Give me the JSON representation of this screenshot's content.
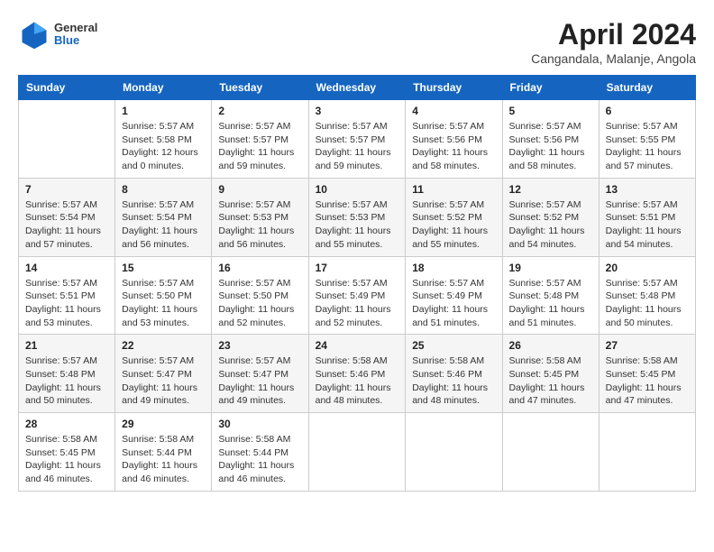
{
  "header": {
    "logo": {
      "general": "General",
      "blue": "Blue"
    },
    "title": "April 2024",
    "subtitle": "Cangandala, Malanje, Angola"
  },
  "calendar": {
    "weekdays": [
      "Sunday",
      "Monday",
      "Tuesday",
      "Wednesday",
      "Thursday",
      "Friday",
      "Saturday"
    ],
    "weeks": [
      [
        {
          "day": "",
          "info": ""
        },
        {
          "day": "1",
          "info": "Sunrise: 5:57 AM\nSunset: 5:58 PM\nDaylight: 12 hours\nand 0 minutes."
        },
        {
          "day": "2",
          "info": "Sunrise: 5:57 AM\nSunset: 5:57 PM\nDaylight: 11 hours\nand 59 minutes."
        },
        {
          "day": "3",
          "info": "Sunrise: 5:57 AM\nSunset: 5:57 PM\nDaylight: 11 hours\nand 59 minutes."
        },
        {
          "day": "4",
          "info": "Sunrise: 5:57 AM\nSunset: 5:56 PM\nDaylight: 11 hours\nand 58 minutes."
        },
        {
          "day": "5",
          "info": "Sunrise: 5:57 AM\nSunset: 5:56 PM\nDaylight: 11 hours\nand 58 minutes."
        },
        {
          "day": "6",
          "info": "Sunrise: 5:57 AM\nSunset: 5:55 PM\nDaylight: 11 hours\nand 57 minutes."
        }
      ],
      [
        {
          "day": "7",
          "info": "Sunrise: 5:57 AM\nSunset: 5:54 PM\nDaylight: 11 hours\nand 57 minutes."
        },
        {
          "day": "8",
          "info": "Sunrise: 5:57 AM\nSunset: 5:54 PM\nDaylight: 11 hours\nand 56 minutes."
        },
        {
          "day": "9",
          "info": "Sunrise: 5:57 AM\nSunset: 5:53 PM\nDaylight: 11 hours\nand 56 minutes."
        },
        {
          "day": "10",
          "info": "Sunrise: 5:57 AM\nSunset: 5:53 PM\nDaylight: 11 hours\nand 55 minutes."
        },
        {
          "day": "11",
          "info": "Sunrise: 5:57 AM\nSunset: 5:52 PM\nDaylight: 11 hours\nand 55 minutes."
        },
        {
          "day": "12",
          "info": "Sunrise: 5:57 AM\nSunset: 5:52 PM\nDaylight: 11 hours\nand 54 minutes."
        },
        {
          "day": "13",
          "info": "Sunrise: 5:57 AM\nSunset: 5:51 PM\nDaylight: 11 hours\nand 54 minutes."
        }
      ],
      [
        {
          "day": "14",
          "info": "Sunrise: 5:57 AM\nSunset: 5:51 PM\nDaylight: 11 hours\nand 53 minutes."
        },
        {
          "day": "15",
          "info": "Sunrise: 5:57 AM\nSunset: 5:50 PM\nDaylight: 11 hours\nand 53 minutes."
        },
        {
          "day": "16",
          "info": "Sunrise: 5:57 AM\nSunset: 5:50 PM\nDaylight: 11 hours\nand 52 minutes."
        },
        {
          "day": "17",
          "info": "Sunrise: 5:57 AM\nSunset: 5:49 PM\nDaylight: 11 hours\nand 52 minutes."
        },
        {
          "day": "18",
          "info": "Sunrise: 5:57 AM\nSunset: 5:49 PM\nDaylight: 11 hours\nand 51 minutes."
        },
        {
          "day": "19",
          "info": "Sunrise: 5:57 AM\nSunset: 5:48 PM\nDaylight: 11 hours\nand 51 minutes."
        },
        {
          "day": "20",
          "info": "Sunrise: 5:57 AM\nSunset: 5:48 PM\nDaylight: 11 hours\nand 50 minutes."
        }
      ],
      [
        {
          "day": "21",
          "info": "Sunrise: 5:57 AM\nSunset: 5:48 PM\nDaylight: 11 hours\nand 50 minutes."
        },
        {
          "day": "22",
          "info": "Sunrise: 5:57 AM\nSunset: 5:47 PM\nDaylight: 11 hours\nand 49 minutes."
        },
        {
          "day": "23",
          "info": "Sunrise: 5:57 AM\nSunset: 5:47 PM\nDaylight: 11 hours\nand 49 minutes."
        },
        {
          "day": "24",
          "info": "Sunrise: 5:58 AM\nSunset: 5:46 PM\nDaylight: 11 hours\nand 48 minutes."
        },
        {
          "day": "25",
          "info": "Sunrise: 5:58 AM\nSunset: 5:46 PM\nDaylight: 11 hours\nand 48 minutes."
        },
        {
          "day": "26",
          "info": "Sunrise: 5:58 AM\nSunset: 5:45 PM\nDaylight: 11 hours\nand 47 minutes."
        },
        {
          "day": "27",
          "info": "Sunrise: 5:58 AM\nSunset: 5:45 PM\nDaylight: 11 hours\nand 47 minutes."
        }
      ],
      [
        {
          "day": "28",
          "info": "Sunrise: 5:58 AM\nSunset: 5:45 PM\nDaylight: 11 hours\nand 46 minutes."
        },
        {
          "day": "29",
          "info": "Sunrise: 5:58 AM\nSunset: 5:44 PM\nDaylight: 11 hours\nand 46 minutes."
        },
        {
          "day": "30",
          "info": "Sunrise: 5:58 AM\nSunset: 5:44 PM\nDaylight: 11 hours\nand 46 minutes."
        },
        {
          "day": "",
          "info": ""
        },
        {
          "day": "",
          "info": ""
        },
        {
          "day": "",
          "info": ""
        },
        {
          "day": "",
          "info": ""
        }
      ]
    ]
  }
}
